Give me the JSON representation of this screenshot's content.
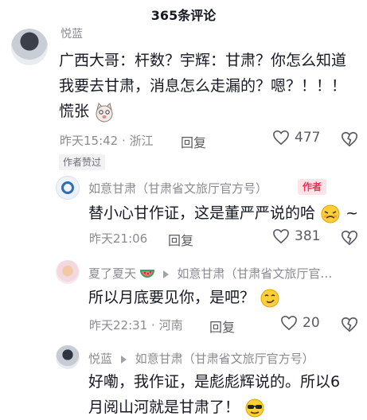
{
  "header": {
    "title": "365条评论"
  },
  "comments": [
    {
      "username": "悦蓝",
      "text_line1": "广西大哥：杆数？宇辉：甘肃？你怎么知道",
      "text_line2": "我要去甘肃，消息怎么走漏的？嗯？！！！",
      "text_line3": "慌张",
      "emoji": "cat-panic-emoji",
      "time": "昨天15:42",
      "location": "浙江",
      "reply_label": "回复",
      "likes": "477",
      "badge": "作者赞过"
    },
    {
      "username": "如意甘肃（甘肃省文旅厅官方号）",
      "author_tag": "作者",
      "text": "替小心甘作证，这是董严严说的哈",
      "suffix": "~",
      "emoji": "awkward-face-emoji",
      "time": "昨天21:06",
      "reply_label": "回复",
      "likes": "381"
    },
    {
      "username": "夏了夏天",
      "username_emoji": "watermelon-emoji",
      "reply_to": "如意甘肃（甘肃省文旅厅官…",
      "text": "所以月底要见你，是吧？",
      "emoji": "smirk-face-emoji",
      "time": "昨天22:31",
      "location": "河南",
      "reply_label": "回复",
      "likes": "20"
    },
    {
      "username": "悦蓝",
      "reply_to": "如意甘肃（甘肃省文旅厅官方号）",
      "text_line1": "好嘞，我作证，是彪彪辉说的。所以6",
      "text_line2": "月阅山河就是甘肃了！",
      "emoji": "sunglasses-face-emoji"
    }
  ],
  "separator": "·",
  "colors": {
    "author_tag": "#fe2c55",
    "meta_text": "#8a8b91",
    "body_text": "#161823"
  }
}
